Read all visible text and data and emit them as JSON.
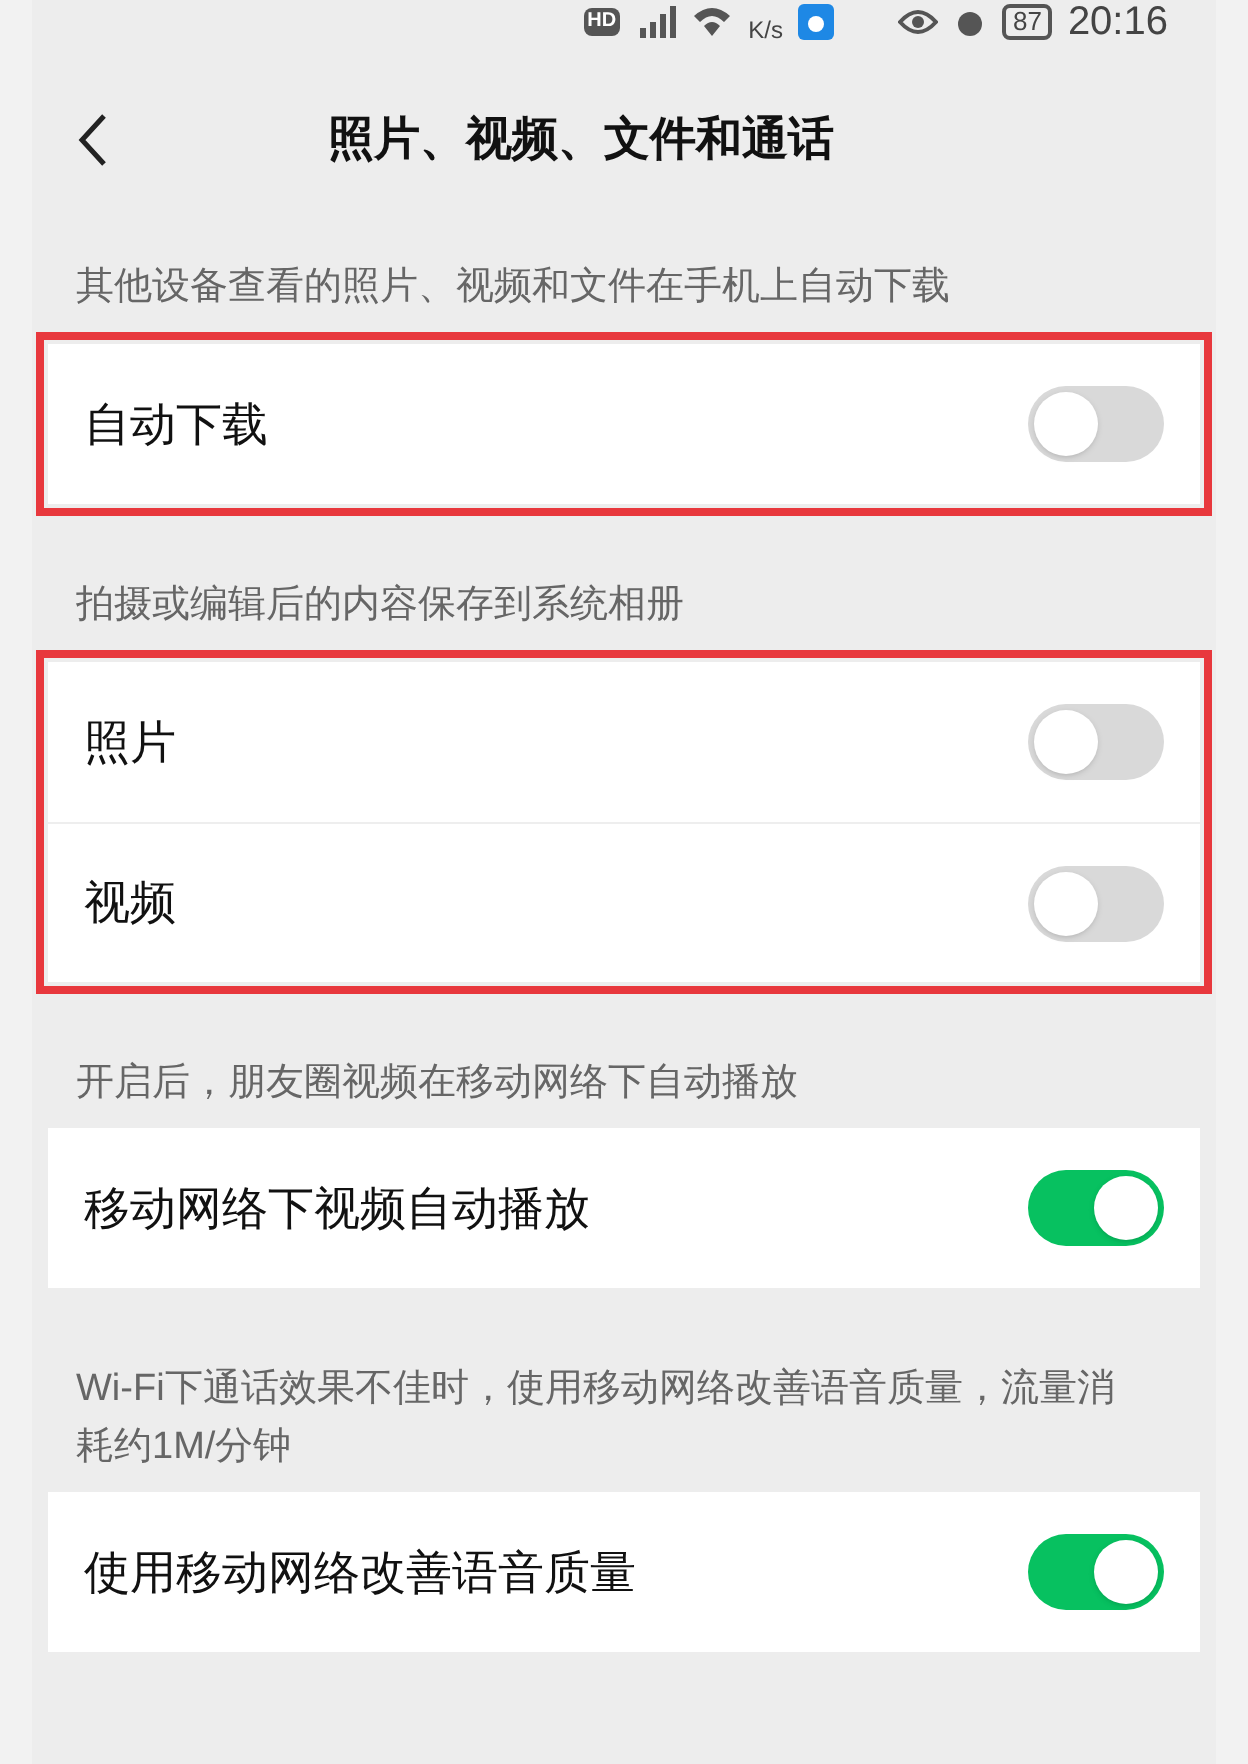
{
  "status_bar": {
    "hd_badge": "HD",
    "network_speed_unit": "K/s",
    "battery": "87",
    "time": "20:16"
  },
  "header": {
    "title": "照片、视频、文件和通话"
  },
  "groups": [
    {
      "caption": "其他设备查看的照片、视频和文件在手机上自动下载",
      "highlighted": true,
      "rows": [
        {
          "label": "自动下载",
          "on": false
        }
      ]
    },
    {
      "caption": "拍摄或编辑后的内容保存到系统相册",
      "highlighted": true,
      "rows": [
        {
          "label": "照片",
          "on": false
        },
        {
          "label": "视频",
          "on": false
        }
      ]
    },
    {
      "caption": "开启后，朋友圈视频在移动网络下自动播放",
      "highlighted": false,
      "rows": [
        {
          "label": "移动网络下视频自动播放",
          "on": true
        }
      ]
    },
    {
      "caption": "Wi-Fi下通话效果不佳时，使用移动网络改善语音质量，流量消耗约1M/分钟",
      "highlighted": false,
      "rows": [
        {
          "label": "使用移动网络改善语音质量",
          "on": true
        }
      ]
    }
  ]
}
